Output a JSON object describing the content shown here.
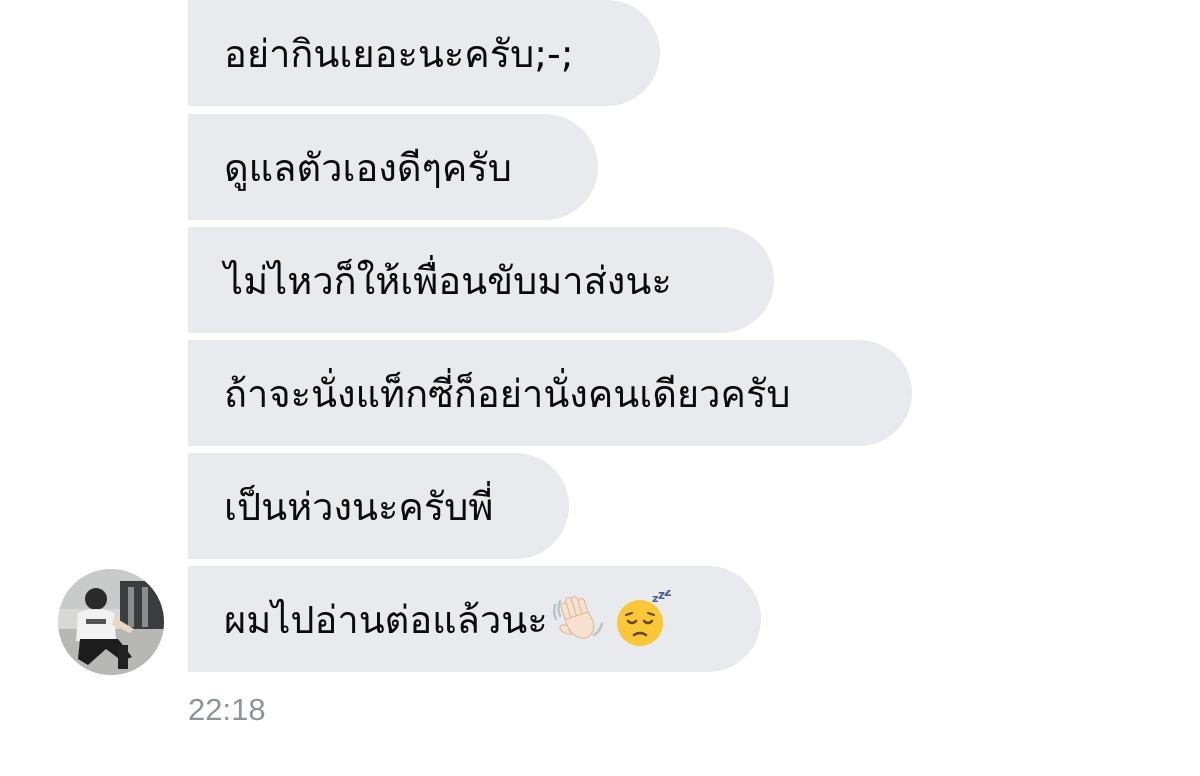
{
  "conversation": {
    "messages": [
      {
        "text": "อย่ากินเยอะนะครับ;-;"
      },
      {
        "text": "ดูแลตัวเองดีๆครับ"
      },
      {
        "text": "ไม่ไหวก็ให้เพื่อนขับมาส่งนะ"
      },
      {
        "text": "ถ้าจะนั่งแท็กซี่ก็อย่านั่งคนเดียวครับ"
      },
      {
        "text": "เป็นห่วงนะครับพี่"
      },
      {
        "text": "ผมไปอ่านต่อแล้วนะ",
        "emojis": [
          "waving-hand-icon",
          "sleeping-face-icon"
        ]
      }
    ],
    "timestamp": "22:18"
  },
  "colors": {
    "bubble_background": "#e9eaee",
    "message_text": "#0b0b0b",
    "timestamp_text": "#8f949c",
    "page_background": "#ffffff"
  }
}
